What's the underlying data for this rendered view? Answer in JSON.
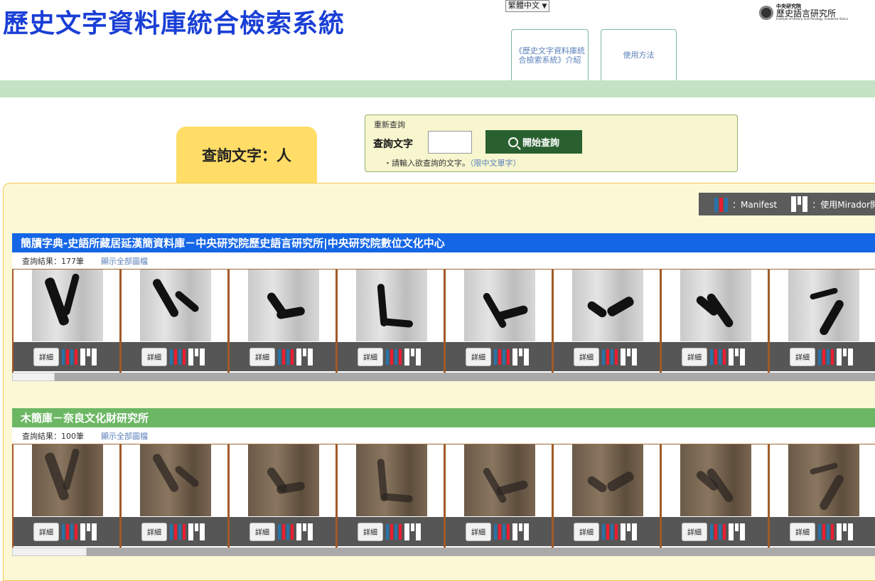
{
  "header": {
    "title": "歷史文字資料庫統合檢索系統",
    "language_selected": "繁體中文",
    "language_arrow": "▼",
    "logo": {
      "small": "中央研究院",
      "main": "歷史語言研究所",
      "english": "Institute of History and Philology, Academia Sinica"
    },
    "nav": [
      {
        "label": "《歷史文字資料庫統合檢索系統》介紹"
      },
      {
        "label": "使用方法"
      }
    ]
  },
  "query": {
    "tab_label": "查詢文字：人",
    "requery_title": "重新查詢",
    "field_label": "查詢文字",
    "input_value": "",
    "button_label": "開始查詢",
    "hint_prefix": "・請輸入欲查詢的文字。",
    "hint_note": "（限中文單字）"
  },
  "legend": {
    "manifest_label": "：Manifest",
    "mirador_label": "：使用Mirador開"
  },
  "sections": [
    {
      "title": "簡牘字典-史語所藏居延漢簡資料庫－中央研究院歷史語言研究所|中央研究院數位文化中心",
      "result_count": "查詢結果：177筆",
      "show_all": "顯示全部圖檔",
      "detail_label": "詳細",
      "header_color": "#1566e6",
      "thumb_count": 8,
      "scroll_position": 0.0
    },
    {
      "title": "木簡庫－奈良文化財研究所",
      "result_count": "查詢結果：100筆",
      "show_all": "顯示全部圖檔",
      "detail_label": "詳細",
      "header_color": "#6cb764",
      "thumb_count": 8,
      "scroll_position": 0.0
    }
  ],
  "colors": {
    "title_blue": "#1a3fd6",
    "green_band": "#c3e3c4",
    "query_tab": "#ffdd66",
    "panel_bg": "#fcf8d6",
    "search_button": "#2a6030",
    "iiif_blue": "#2873ab",
    "iiif_red": "#ed1d33"
  }
}
